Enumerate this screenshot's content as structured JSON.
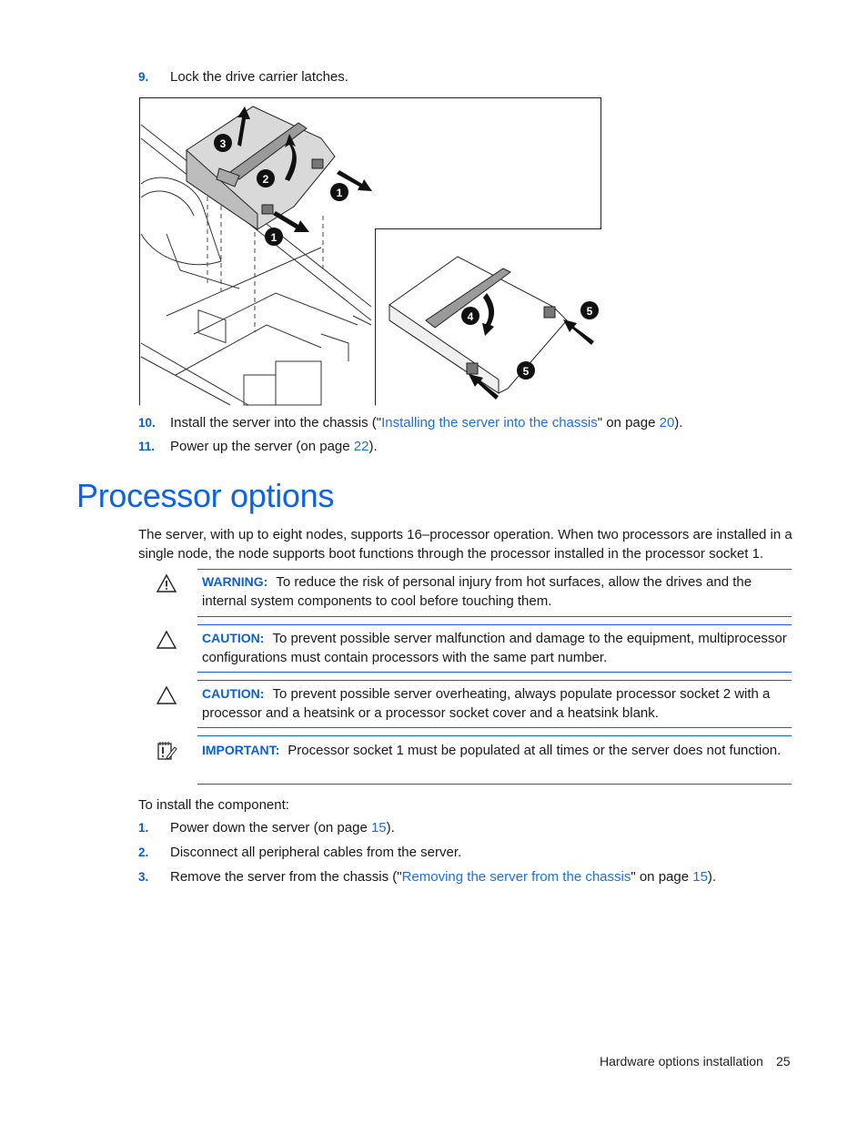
{
  "top_steps": [
    {
      "num": "9.",
      "text": "Lock the drive carrier latches."
    },
    {
      "num": "10.",
      "pre": "Install the server into the chassis (\"",
      "link": "Installing the server into the chassis",
      "mid": "\" on page ",
      "page": "20",
      "post": ")."
    },
    {
      "num": "11.",
      "pre": "Power up the server (on page ",
      "page": "22",
      "post": ")."
    }
  ],
  "figure": {
    "description": "Drive carrier latch illustration",
    "callouts": [
      "1",
      "1",
      "2",
      "3",
      "4",
      "5",
      "5"
    ]
  },
  "section": {
    "title": "Processor options",
    "intro": "The server, with up to eight nodes, supports 16–processor operation. When two processors are installed in a single node, the node supports boot functions through the processor installed in the processor socket 1."
  },
  "notes": [
    {
      "type": "warning",
      "icon": "warning-icon",
      "label": "WARNING:",
      "text": "To reduce the risk of personal injury from hot surfaces, allow the drives and the internal system components to cool before touching them."
    },
    {
      "type": "caution",
      "icon": "caution-icon",
      "label": "CAUTION:",
      "text": "To prevent possible server malfunction and damage to the equipment, multiprocessor configurations must contain processors with the same part number."
    },
    {
      "type": "caution",
      "icon": "caution-icon",
      "label": "CAUTION:",
      "text": "To prevent possible server overheating, always populate processor socket 2 with a processor and a heatsink or a processor socket cover and a heatsink blank."
    },
    {
      "type": "important",
      "icon": "important-icon",
      "label": "IMPORTANT:",
      "text": "Processor socket 1 must be populated at all times or the server does not function."
    }
  ],
  "install": {
    "lead": "To install the component:",
    "steps": [
      {
        "num": "1.",
        "pre": "Power down the server (on page ",
        "page": "15",
        "post": ")."
      },
      {
        "num": "2.",
        "text": "Disconnect all peripheral cables from the server."
      },
      {
        "num": "3.",
        "pre": "Remove the server from the chassis (\"",
        "link": "Removing the server from the chassis",
        "mid": "\" on page ",
        "page": "15",
        "post": ")."
      }
    ]
  },
  "footer": {
    "section": "Hardware options installation",
    "page": "25"
  }
}
